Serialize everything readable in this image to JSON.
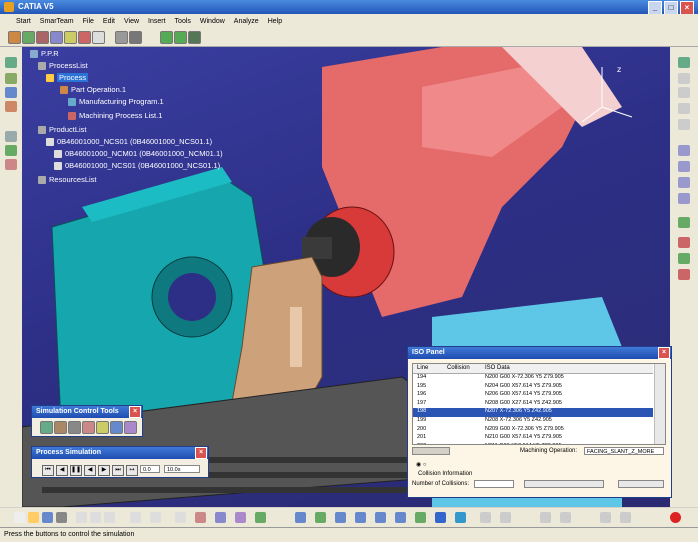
{
  "window": {
    "title": "CATIA V5"
  },
  "menubar": [
    "Start",
    "SmarTeam",
    "File",
    "Edit",
    "View",
    "Insert",
    "Tools",
    "Window",
    "Analyze",
    "Help"
  ],
  "tree": {
    "root": "P.P.R",
    "process_list": "ProcessList",
    "process": "Process",
    "part_operation": "Part Operation.1",
    "manufacturing_program": "Manufacturing Program.1",
    "machining_process_list": "Machining Process List.1",
    "product_list": "ProductList",
    "products": [
      "0B46001000_NCS01 (0B46001000_NCS01.1)",
      "0B46001000_NCM01 (0B46001000_NCM01.1)",
      "0B46001000_NCS01 (0B46001000_NCS01.1)"
    ],
    "resources_list": "ResourcesList"
  },
  "iso_panel": {
    "title": "ISO Panel",
    "columns": [
      "Line",
      "Collision",
      "ISO Data"
    ],
    "rows": [
      {
        "line": "194",
        "collision": "",
        "iso": "N200 G00 X-72.306 Y5 Z79.905"
      },
      {
        "line": "195",
        "collision": "",
        "iso": "N204 G00 X57.614 Y5 Z79.905"
      },
      {
        "line": "196",
        "collision": "",
        "iso": "N206 G00 X57.614 Y5 Z79.905"
      },
      {
        "line": "197",
        "collision": "",
        "iso": "N208 G00 X27.614 Y5 Z42.905"
      },
      {
        "line": "198",
        "collision": "",
        "iso": "N207 X-72.306 Y5 Z42.905"
      },
      {
        "line": "199",
        "collision": "",
        "iso": "N208 X-72.306 Y5 Z42.905"
      },
      {
        "line": "200",
        "collision": "",
        "iso": "N209 G00 X-72.306 Y5 Z79.905"
      },
      {
        "line": "201",
        "collision": "",
        "iso": "N210 G00 X57.614 Y5 Z79.905"
      },
      {
        "line": "202",
        "collision": "",
        "iso": "N211 G00 X57.614 Y5 Z38.905"
      }
    ],
    "highlighted_index": 4,
    "machining_operation_label": "Machining Operation:",
    "machining_operation_value": "FACING_SLANT_Z_MORE",
    "collision_info_label": "Collision Information",
    "num_collisions_label": "Number of Collisions:"
  },
  "sim_control": {
    "title": "Simulation Control Tools"
  },
  "process_sim": {
    "title": "Process Simulation",
    "step_value": "0.0",
    "time_value": "10.0s"
  },
  "status": {
    "text": "Press the buttons to control the simulation"
  },
  "colors": {
    "bg_blue": "#2d2f86",
    "machine_red": "#e86868",
    "table_cyan": "#16a7ae",
    "highlight": "#2b55b5"
  }
}
